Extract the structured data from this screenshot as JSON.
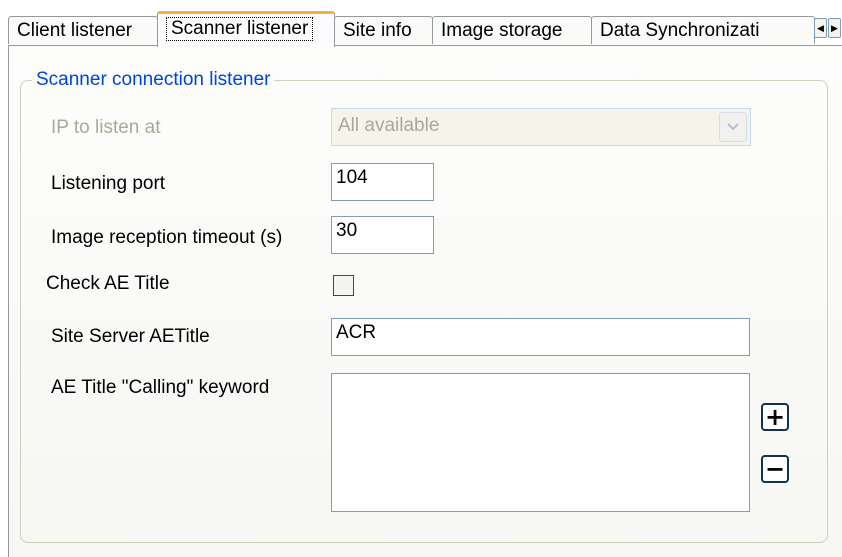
{
  "tabs": [
    {
      "label": "Client listener"
    },
    {
      "label": "Scanner listener"
    },
    {
      "label": "Site info"
    },
    {
      "label": "Image storage"
    },
    {
      "label": "Data Synchronizati"
    }
  ],
  "tab_scroll": {
    "left_glyph": "◀",
    "right_glyph": "▶"
  },
  "group": {
    "legend": "Scanner connection listener",
    "ip": {
      "label": "IP to listen at",
      "value": "All available",
      "arrow_glyph": "⌄"
    },
    "port": {
      "label": "Listening port",
      "value": "104"
    },
    "timeout": {
      "label": "Image reception timeout (s)",
      "value": "30"
    },
    "check_ae": {
      "label": "Check AE Title",
      "checked": false
    },
    "site_server": {
      "label": "Site Server AETitle",
      "value": "ACR"
    },
    "calling_keyword": {
      "label": "AE Title \"Calling\" keyword",
      "value": ""
    },
    "add_glyph": "+",
    "remove_glyph": "−"
  },
  "colors": {
    "legend": "#0046d5",
    "active_tab_accent": "#f0b046",
    "disabled_text": "#aca899"
  }
}
